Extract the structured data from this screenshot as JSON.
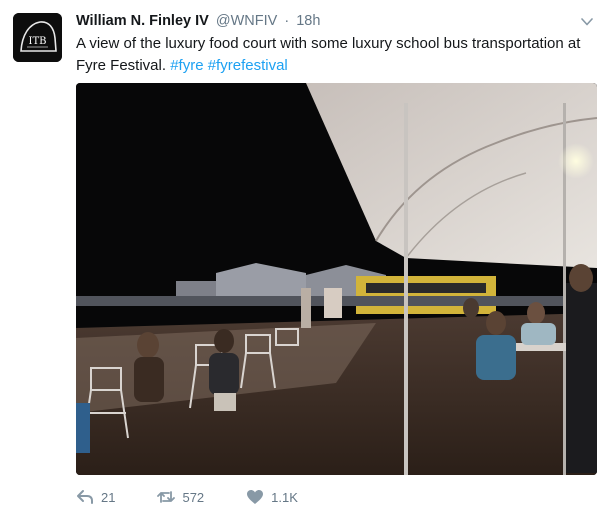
{
  "tweet": {
    "avatar_label": "ITB",
    "author_name": "William N. Finley IV",
    "handle": "@WNFIV",
    "separator": "·",
    "time": "18h",
    "text": "A view of the luxury food court with some luxury school bus transportation at Fyre Festival. ",
    "hashtags": [
      "#fyre",
      "#fyrefestival"
    ],
    "actions": {
      "reply_count": "21",
      "retweet_count": "572",
      "like_count": "1.1K"
    }
  },
  "colors": {
    "link": "#1da1f2",
    "muted": "#657786",
    "text": "#14171a"
  },
  "icons": [
    "caret-down-icon",
    "reply-icon",
    "retweet-icon",
    "heart-icon"
  ]
}
